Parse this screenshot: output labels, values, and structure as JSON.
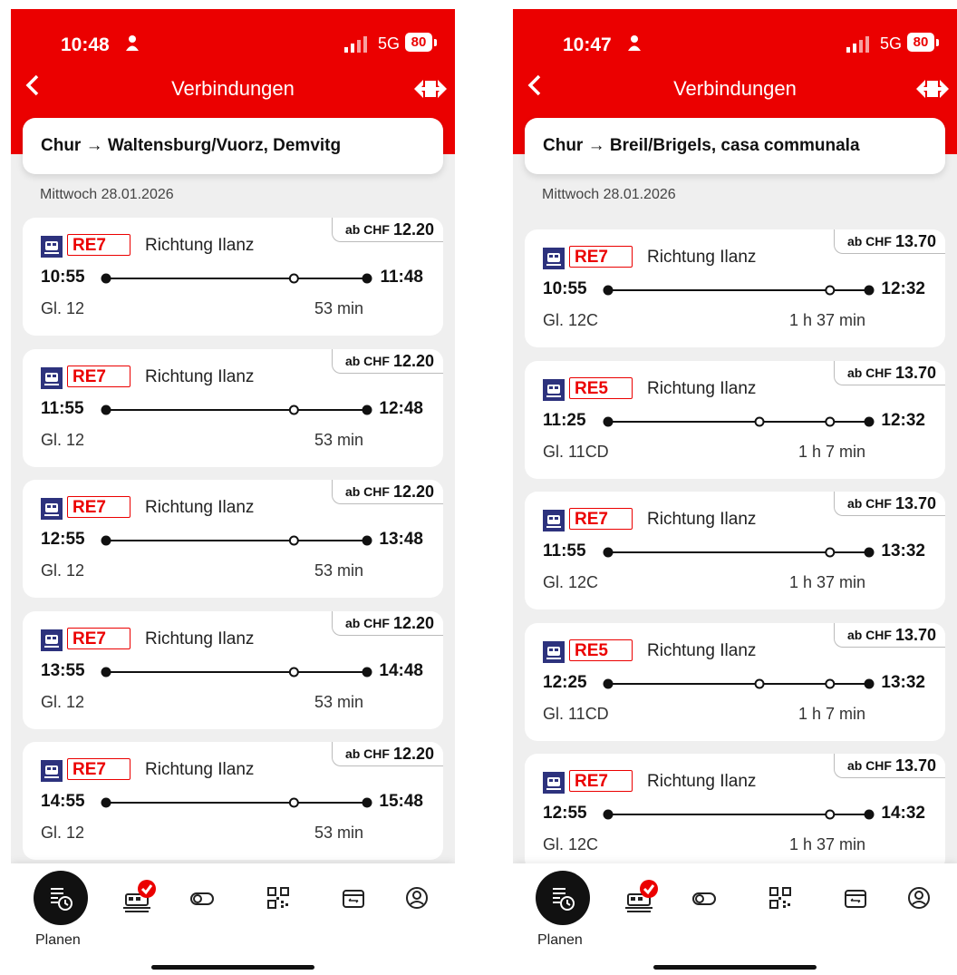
{
  "screens": [
    {
      "status": {
        "time": "10:48",
        "network": "5G",
        "battery": "80"
      },
      "header": {
        "title": "Verbindungen",
        "back_icon": "chevron-left-icon",
        "logo_icon": "sbb-logo-icon"
      },
      "route": "Chur → Waltensburg/Vuorz, Demvitg",
      "date": "Mittwoch 28.01.2026",
      "connections": [
        {
          "price_prefix": "ab CHF",
          "price": "12.20",
          "line": "RE7",
          "direction": "Richtung Ilanz",
          "departure": "10:55",
          "arrival": "11:48",
          "platform": "Gl. 12",
          "duration": "53 min",
          "stops": [
            0.72
          ]
        },
        {
          "price_prefix": "ab CHF",
          "price": "12.20",
          "line": "RE7",
          "direction": "Richtung Ilanz",
          "departure": "11:55",
          "arrival": "12:48",
          "platform": "Gl. 12",
          "duration": "53 min",
          "stops": [
            0.72
          ]
        },
        {
          "price_prefix": "ab CHF",
          "price": "12.20",
          "line": "RE7",
          "direction": "Richtung Ilanz",
          "departure": "12:55",
          "arrival": "13:48",
          "platform": "Gl. 12",
          "duration": "53 min",
          "stops": [
            0.72
          ]
        },
        {
          "price_prefix": "ab CHF",
          "price": "12.20",
          "line": "RE7",
          "direction": "Richtung Ilanz",
          "departure": "13:55",
          "arrival": "14:48",
          "platform": "Gl. 12",
          "duration": "53 min",
          "stops": [
            0.72
          ]
        },
        {
          "price_prefix": "ab CHF",
          "price": "12.20",
          "line": "RE7",
          "direction": "Richtung Ilanz",
          "departure": "14:55",
          "arrival": "15:48",
          "platform": "Gl. 12",
          "duration": "53 min",
          "stops": [
            0.72
          ]
        }
      ],
      "tabbar": {
        "active_label": "Planen"
      }
    },
    {
      "status": {
        "time": "10:47",
        "network": "5G",
        "battery": "80"
      },
      "header": {
        "title": "Verbindungen",
        "back_icon": "chevron-left-icon",
        "logo_icon": "sbb-logo-icon"
      },
      "route": "Chur → Breil/Brigels, casa communala",
      "date": "Mittwoch 28.01.2026",
      "connections": [
        {
          "price_prefix": "ab CHF",
          "price": "13.70",
          "line": "RE7",
          "direction": "Richtung Ilanz",
          "departure": "10:55",
          "arrival": "12:32",
          "platform": "Gl. 12C",
          "duration": "1 h 37 min",
          "stops": [
            0.85
          ]
        },
        {
          "price_prefix": "ab CHF",
          "price": "13.70",
          "line": "RE5",
          "direction": "Richtung Ilanz",
          "departure": "11:25",
          "arrival": "12:32",
          "platform": "Gl. 11CD",
          "duration": "1 h 7 min",
          "stops": [
            0.58,
            0.85
          ]
        },
        {
          "price_prefix": "ab CHF",
          "price": "13.70",
          "line": "RE7",
          "direction": "Richtung Ilanz",
          "departure": "11:55",
          "arrival": "13:32",
          "platform": "Gl. 12C",
          "duration": "1 h 37 min",
          "stops": [
            0.85
          ]
        },
        {
          "price_prefix": "ab CHF",
          "price": "13.70",
          "line": "RE5",
          "direction": "Richtung Ilanz",
          "departure": "12:25",
          "arrival": "13:32",
          "platform": "Gl. 11CD",
          "duration": "1 h 7 min",
          "stops": [
            0.58,
            0.85
          ]
        },
        {
          "price_prefix": "ab CHF",
          "price": "13.70",
          "line": "RE7",
          "direction": "Richtung Ilanz",
          "departure": "12:55",
          "arrival": "14:32",
          "platform": "Gl. 12C",
          "duration": "1 h 37 min",
          "stops": [
            0.85
          ]
        }
      ],
      "tabbar": {
        "active_label": "Planen"
      }
    }
  ],
  "tab_icons": [
    "planen-timetable-icon",
    "tickets-train-icon",
    "toggle-icon",
    "qr-code-icon",
    "ticket-counter-icon",
    "profile-icon"
  ],
  "colors": {
    "brand_red": "#eb0000",
    "active_tab": "#111111",
    "check_badge": "#eb0000"
  }
}
